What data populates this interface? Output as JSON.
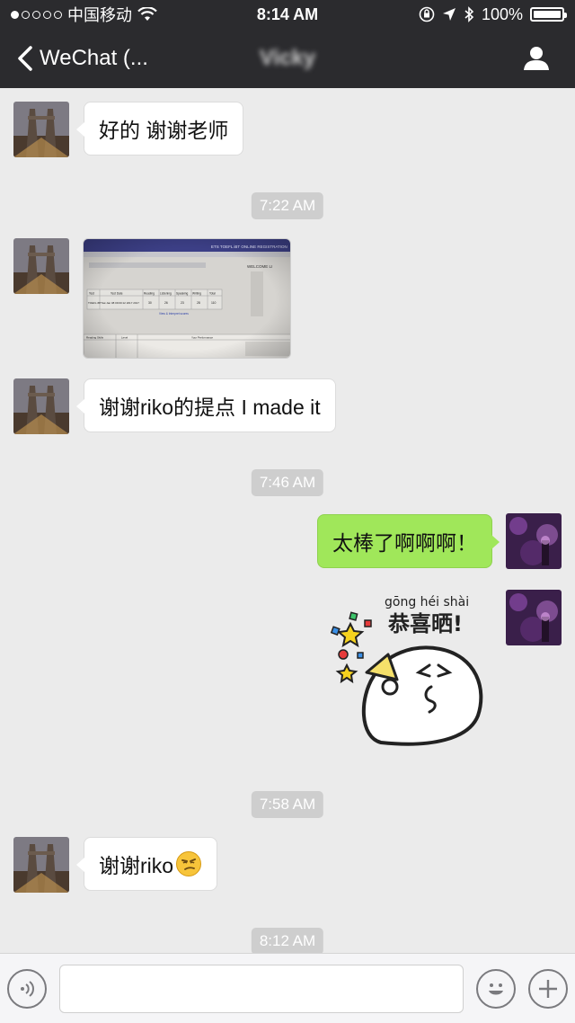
{
  "status_bar": {
    "carrier": "中国移动",
    "time": "8:14 AM",
    "battery": "100%"
  },
  "nav": {
    "back_label": "WeChat (...",
    "title": "Vicky"
  },
  "messages": [
    {
      "side": "left",
      "type": "text",
      "text": "好的 谢谢老师"
    },
    {
      "type": "timestamp",
      "text": "7:22 AM"
    },
    {
      "side": "left",
      "type": "image",
      "description": "registration page photo",
      "image_text": {
        "header": "ETS TOEFL iBT ONLINE REGISTRATION",
        "welcome": "WELCOME LI",
        "table_headers": [
          "Test",
          "Test Date",
          "Reading",
          "Listening",
          "Speaking",
          "Writing",
          "Total"
        ],
        "row": [
          "TOEFL iBT",
          "Sat Jan 08 09:00:12 2017 2017",
          "30",
          "26",
          "23",
          "28",
          "110"
        ],
        "link": "View & Interpret scores",
        "lower_headers": [
          "Reading Skills",
          "Level",
          "Your Performance"
        ]
      }
    },
    {
      "side": "left",
      "type": "text",
      "text": "谢谢riko的提点 I made it"
    },
    {
      "type": "timestamp",
      "text": "7:46 AM"
    },
    {
      "side": "right",
      "type": "text",
      "text": "太棒了啊啊啊！"
    },
    {
      "side": "right",
      "type": "sticker",
      "sticker_text": {
        "pinyin": "gōng héi shài",
        "chinese": "恭喜晒!"
      }
    },
    {
      "type": "timestamp",
      "text": "7:58 AM"
    },
    {
      "side": "left",
      "type": "text",
      "text": "谢谢riko",
      "emoji": "smirk-emoji"
    },
    {
      "type": "timestamp",
      "text": "8:12 AM"
    }
  ],
  "colors": {
    "nav_bg": "#2b2b2e",
    "chat_bg": "#ebebeb",
    "bubble_left": "#ffffff",
    "bubble_right": "#a0e75a",
    "timestamp_bg": "#cecece"
  },
  "icons": {
    "back": "chevron-left-icon",
    "contact": "person-icon",
    "voice": "voice-icon",
    "emoji": "emoji-icon",
    "add": "plus-icon"
  }
}
